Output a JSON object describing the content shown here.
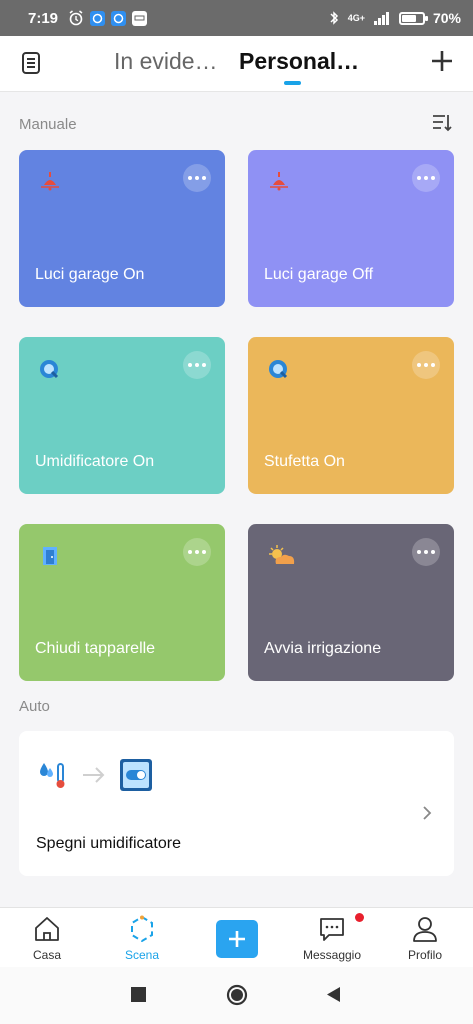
{
  "status_bar": {
    "time": "7:19",
    "network": "4G+",
    "battery": "70%",
    "battery_level": 0.7
  },
  "header": {
    "tabs": [
      {
        "label": "In evide…"
      },
      {
        "label": "Personal…"
      }
    ],
    "active_tab": 1,
    "accent": "#1aa3e8"
  },
  "manual": {
    "title": "Manuale",
    "cards": [
      {
        "name": "Luci garage On",
        "color": "#6283e1",
        "icon": "ceiling-lamp-icon"
      },
      {
        "name": "Luci garage Off",
        "color": "#8f91f4",
        "icon": "ceiling-lamp-icon"
      },
      {
        "name": "Umidificatore On",
        "color": "#6ccfc4",
        "icon": "device-round-icon"
      },
      {
        "name": "Stufetta On",
        "color": "#ebb75a",
        "icon": "device-round-icon"
      },
      {
        "name": "Chiudi tapparelle",
        "color": "#95c86c",
        "icon": "door-icon"
      },
      {
        "name": "Avvia irrigazione",
        "color": "#696676",
        "icon": "sun-cloud-icon"
      }
    ]
  },
  "auto": {
    "title": "Auto",
    "automation": {
      "name": "Spegni umidificatore",
      "trigger_icon": "humidity-thermometer-icon",
      "action_icon": "switch-icon"
    }
  },
  "bottom_nav": {
    "items": [
      {
        "label": "Casa",
        "icon": "home-icon"
      },
      {
        "label": "Scena",
        "icon": "scene-icon"
      },
      {
        "label": "Messaggio",
        "icon": "message-icon"
      },
      {
        "label": "Profilo",
        "icon": "profile-icon"
      }
    ],
    "active": "Scena"
  }
}
